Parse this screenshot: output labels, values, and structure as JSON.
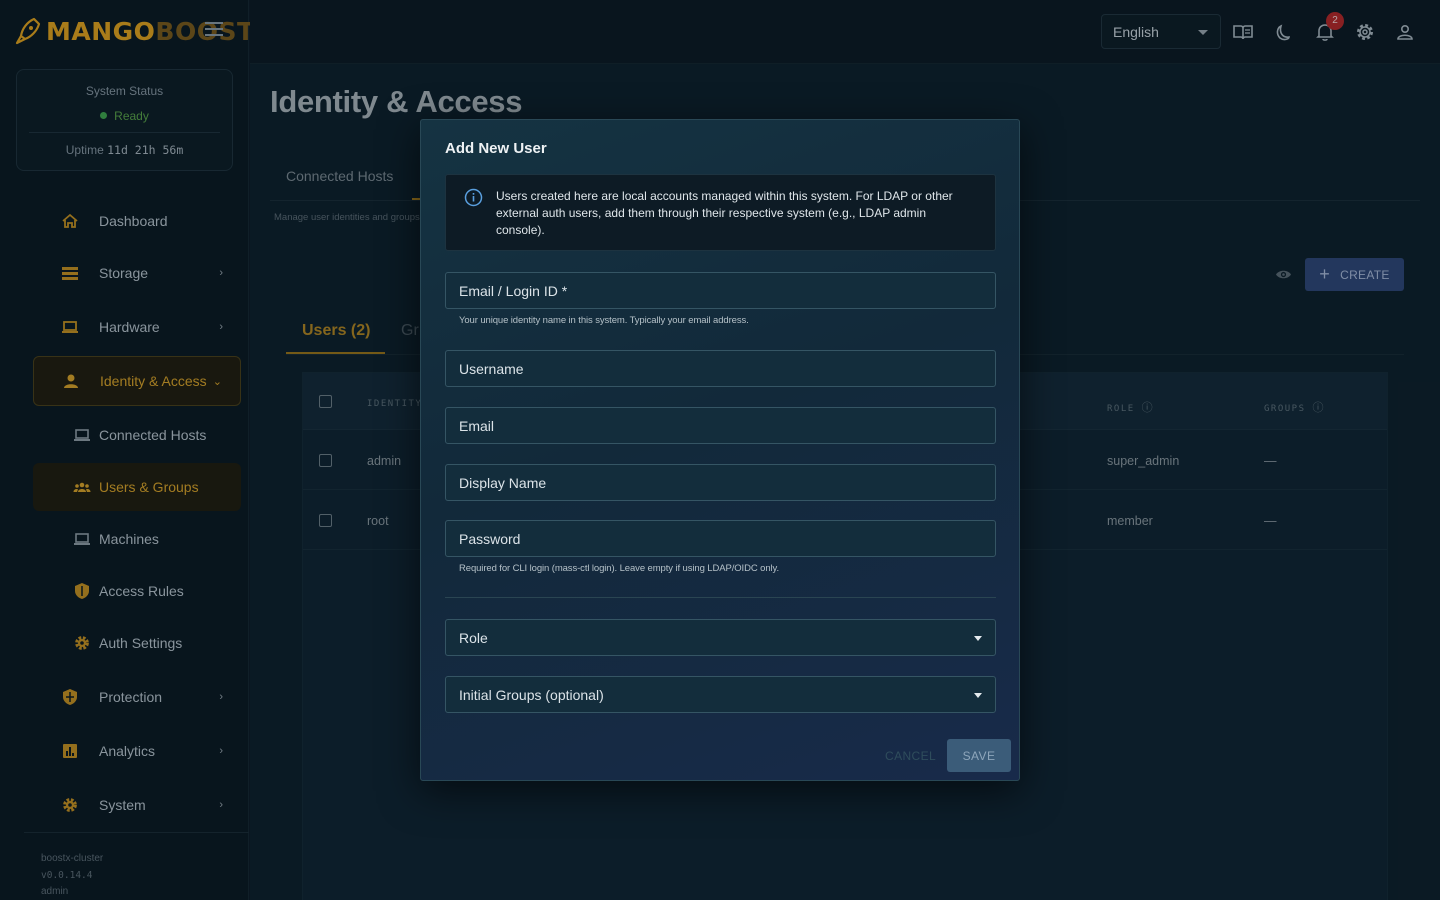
{
  "brand": {
    "name_primary": "MANGO",
    "name_secondary": "BOOST",
    "accent": "#e0a21c"
  },
  "status": {
    "label": "System Status",
    "state": "Ready",
    "uptime_label": "Uptime",
    "uptime_value": "11d 21h 56m"
  },
  "sidebar": {
    "items": [
      {
        "label": "Dashboard",
        "icon": "home-icon"
      },
      {
        "label": "Storage",
        "icon": "storage-icon",
        "chevron": "›"
      },
      {
        "label": "Hardware",
        "icon": "laptop-icon",
        "chevron": "›"
      },
      {
        "label": "Identity & Access",
        "icon": "person-icon",
        "chevron": "⌄"
      },
      {
        "label": "Connected Hosts",
        "icon": "laptop-icon"
      },
      {
        "label": "Users & Groups",
        "icon": "groups-icon"
      },
      {
        "label": "Machines",
        "icon": "laptop-icon"
      },
      {
        "label": "Access Rules",
        "icon": "shield-icon"
      },
      {
        "label": "Auth Settings",
        "icon": "gear-icon"
      },
      {
        "label": "Protection",
        "icon": "shield-icon",
        "chevron": "›"
      },
      {
        "label": "Analytics",
        "icon": "analytics-icon",
        "chevron": "›"
      },
      {
        "label": "System",
        "icon": "gear-icon",
        "chevron": "›"
      }
    ],
    "footer": {
      "cluster": "boostx-cluster",
      "version": "v0.0.14.4",
      "user": "admin"
    }
  },
  "topbar": {
    "language": "English",
    "notification_count": "2"
  },
  "page": {
    "title": "Identity & Access",
    "tab_connected": "Connected Hosts",
    "subtext": "Manage user identities and groups",
    "create_label": "CREATE",
    "users_tab": "Users (2)",
    "groups_tab": "Gr"
  },
  "table": {
    "headers": {
      "identity": "IDENTITY",
      "role": "ROLE",
      "groups": "GROUPS"
    },
    "rows": [
      {
        "identity": "admin",
        "role": "super_admin",
        "groups": "—"
      },
      {
        "identity": "root",
        "role": "member",
        "groups": "—"
      }
    ]
  },
  "modal": {
    "title": "Add New User",
    "info": "Users created here are local accounts managed within this system. For LDAP or other external auth users, add them through their respective system (e.g., LDAP admin console).",
    "fields": {
      "login": "Email / Login ID *",
      "login_hint": "Your unique identity name in this system. Typically your email address.",
      "username": "Username",
      "email": "Email",
      "display_name": "Display Name",
      "password": "Password",
      "password_hint": "Required for CLI login (mass-ctl login). Leave empty if using LDAP/OIDC only.",
      "role": "Role",
      "groups": "Initial Groups (optional)"
    },
    "cancel_label": "CANCEL",
    "save_label": "SAVE"
  }
}
